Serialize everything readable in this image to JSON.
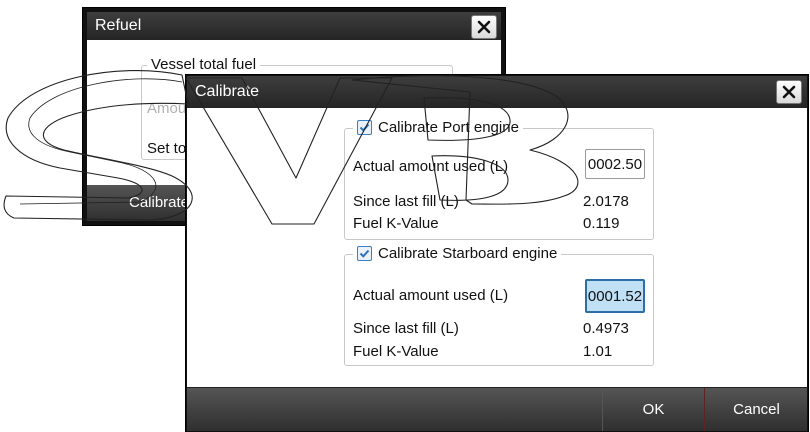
{
  "refuel": {
    "title": "Refuel",
    "group_legend": "Vessel total fuel",
    "amount_label": "Amou",
    "set_to_label": "Set to",
    "footer_calibrate": "Calibrate"
  },
  "calibrate": {
    "title": "Calibrate",
    "port": {
      "checkbox_label": "Calibrate Port engine",
      "checked": true,
      "actual_label": "Actual amount used (L)",
      "actual_value": "0002.50",
      "since_label": "Since last fill (L)",
      "since_value": "2.0178",
      "k_label": "Fuel K-Value",
      "k_value": "0.119"
    },
    "starboard": {
      "checkbox_label": "Calibrate Starboard engine",
      "checked": true,
      "actual_label": "Actual amount used (L)",
      "actual_value": "0001.52",
      "since_label": "Since last fill (L)",
      "since_value": "0.4973",
      "k_label": "Fuel K-Value",
      "k_value": "1.01"
    },
    "ok_label": "OK",
    "cancel_label": "Cancel"
  },
  "colors": {
    "titlebar": "#2b2b2b",
    "checkbox_accent": "#3b7fc4",
    "focused_field": "#bfe0f5"
  },
  "icons": {
    "close": "close-icon",
    "check": "checkmark-icon"
  }
}
